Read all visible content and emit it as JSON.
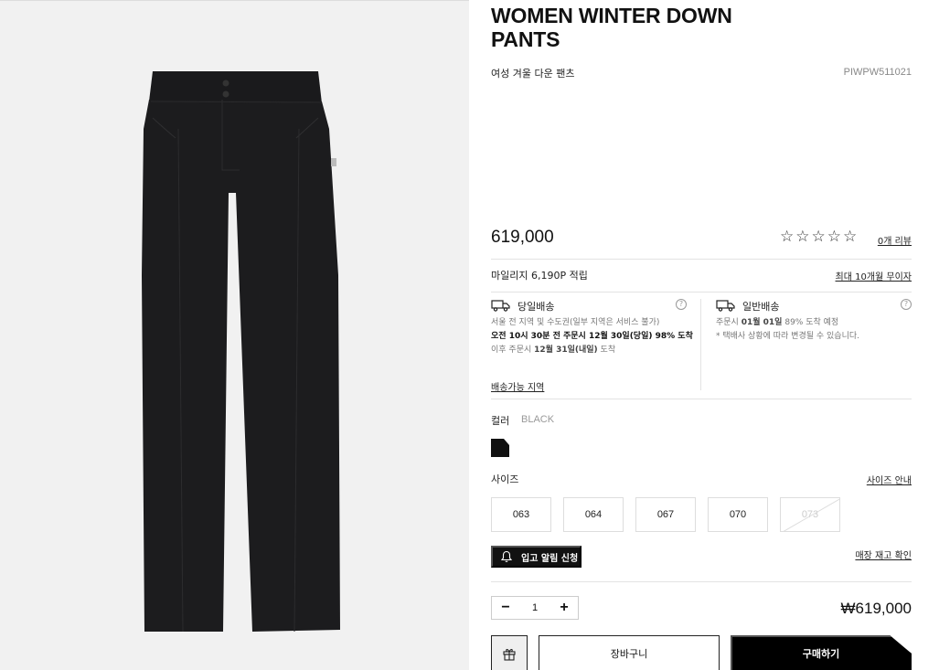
{
  "product": {
    "title": "WOMEN WINTER DOWN PANTS",
    "subtitle": "여성 겨울 다운 팬츠",
    "code": "PIWPW511021",
    "price": "619,000",
    "rating_stars": "☆☆☆☆☆",
    "rating": 0,
    "review_link": "0개 리뷰",
    "image_icon": "pants-product-image",
    "image_color": "#1a1a1c"
  },
  "mileage": {
    "label": "마일리지 6,190P 적립",
    "installment_link": "최대 10개월 무이자"
  },
  "shipping": {
    "same_day": {
      "icon": "delivery-truck-icon",
      "title": "당일배송",
      "line1": "서울 전 지역 및 수도권(일부 지역은 서비스 불가)",
      "line2": "오전 10시 30분 전 주문시 12월 30일(당일) 98% 도착",
      "line3_prefix": "이후 주문시",
      "line3_date": "12월 31일(내일)",
      "line3_suffix": "도착"
    },
    "standard": {
      "icon": "delivery-truck-icon",
      "title": "일반배송",
      "line1_prefix": "주문시",
      "line1_date": "01월 01일",
      "line1_suffix": "89% 도착 예정",
      "line2": "* 택배사 상황에 따라 변경될 수 있습니다."
    },
    "help_glyph": "?",
    "area_link": "배송가능 지역"
  },
  "color": {
    "label": "컬러",
    "value": "BLACK",
    "swatch": "#111111"
  },
  "size": {
    "label": "사이즈",
    "guide_link": "사이즈 안내",
    "options": [
      "063",
      "064",
      "067",
      "070",
      "073"
    ],
    "sold_out": [
      "073"
    ]
  },
  "restock": {
    "button_label": "입고 알림 신청",
    "store_stock_link": "매장 재고 확인"
  },
  "order": {
    "quantity": "1",
    "minus": "−",
    "plus": "+",
    "total": "₩619,000",
    "cart_label": "장바구니",
    "buy_label": "구매하기"
  },
  "colors": {
    "accent": "#000000",
    "muted_text": "#888888",
    "background_image_pane": "#f1f1f1"
  }
}
